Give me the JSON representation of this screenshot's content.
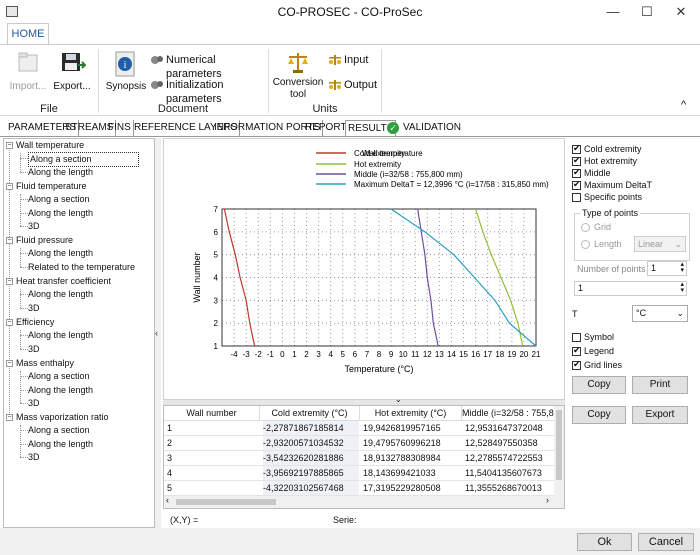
{
  "window": {
    "title": "CO-PROSEC - CO-ProSec",
    "minimize": "—",
    "maximize": "☐",
    "close": "✕"
  },
  "ribbon": {
    "tab": "HOME",
    "file": {
      "import": "Import...",
      "export": "Export...",
      "group": "File"
    },
    "document": {
      "synopsis": "Synopsis",
      "numerical": "Numerical parameters",
      "init": "Initialization parameters",
      "group": "Document"
    },
    "units": {
      "conversion": "Conversion",
      "tool": "tool",
      "input": "Input",
      "output": "Output",
      "group": "Units"
    },
    "collapse": "^"
  },
  "tabs": [
    "PARAMETERS",
    "STREAMS",
    "FINS",
    "REFERENCE LAYERS",
    "INFORMATION PORTS",
    "REPORTS",
    "RESULTS",
    "VALIDATION"
  ],
  "tree": [
    {
      "label": "Wall temperature",
      "children": [
        "Along a section",
        "Along the length"
      ]
    },
    {
      "label": "Fluid temperature",
      "children": [
        "Along a section",
        "Along the length",
        "3D"
      ]
    },
    {
      "label": "Fluid pressure",
      "children": [
        "Along the length",
        "Related to the temperature"
      ]
    },
    {
      "label": "Heat transfer coefficient",
      "children": [
        "Along the length",
        "3D"
      ]
    },
    {
      "label": "Efficiency",
      "children": [
        "Along the length",
        "3D"
      ]
    },
    {
      "label": "Mass enthalpy",
      "children": [
        "Along a section",
        "Along the length",
        "3D"
      ]
    },
    {
      "label": "Mass vaporization ratio",
      "children": [
        "Along a section",
        "Along the length",
        "3D"
      ]
    }
  ],
  "chart_data": {
    "type": "line",
    "legend_overlay": "Wall temperature",
    "series": [
      {
        "name": "Cold extremity",
        "color": "#c0392b",
        "x": [
          -4.8,
          -4.4,
          -3.9,
          -3.5,
          -3.0,
          -2.7,
          -2.3
        ],
        "y": [
          7,
          6,
          5,
          4,
          3,
          2,
          1
        ]
      },
      {
        "name": "Hot extremity",
        "color": "#8fbf3a",
        "x": [
          16,
          16.6,
          17.3,
          18.1,
          18.9,
          19.5,
          19.9
        ],
        "y": [
          7,
          6,
          5,
          4,
          3,
          2,
          1
        ]
      },
      {
        "name": "Middle (i=32/58 : 755,800 mm)",
        "color": "#6b4fa0",
        "x": [
          11.2,
          11.5,
          11.8,
          12.0,
          12.3,
          12.5,
          12.9
        ],
        "y": [
          7,
          6,
          5,
          4,
          3,
          2,
          1
        ]
      },
      {
        "name": "Maximum DeltaT = 12,3996 °C (i=17/58 : 315,850 mm)",
        "color": "#2a9fc4",
        "x": [
          9.0,
          11.8,
          14.2,
          15.9,
          17.6,
          18.8,
          21.0
        ],
        "y": [
          7,
          6,
          5,
          4,
          3,
          2,
          1
        ]
      }
    ],
    "xlabel": "Temperature (°C)",
    "ylabel": "Wall number",
    "xlim": [
      -5,
      21
    ],
    "ylim": [
      1,
      7
    ],
    "xticks": [
      "-4",
      "-3",
      "-2",
      "-1",
      "0",
      "1",
      "2",
      "3",
      "4",
      "5",
      "6",
      "7",
      "8",
      "9",
      "10",
      "11",
      "12",
      "13",
      "14",
      "15",
      "16",
      "17",
      "18",
      "19",
      "20",
      "21"
    ],
    "yticks": [
      "1",
      "2",
      "3",
      "4",
      "5",
      "6",
      "7"
    ],
    "grid": true
  },
  "options": {
    "checks": [
      {
        "label": "Cold extremity",
        "on": true
      },
      {
        "label": "Hot extremity",
        "on": true
      },
      {
        "label": "Middle",
        "on": true
      },
      {
        "label": "Maximum DeltaT",
        "on": true
      },
      {
        "label": "Specific points",
        "on": false
      }
    ],
    "type_group": "Type of points",
    "grid": "Grid",
    "length": "Length",
    "linear": "Linear",
    "num_points_label": "Number of points",
    "num_points": "1",
    "second_value": "1",
    "t_label": "T",
    "t_unit": "°C",
    "symbol": "Symbol",
    "symbol_on": false,
    "legend": "Legend",
    "legend_on": true,
    "gridlines": "Grid lines",
    "gridlines_on": true,
    "copy": "Copy",
    "print": "Print"
  },
  "table": {
    "headers": [
      "Wall number",
      "Cold extremity (°C)",
      "Hot extremity (°C)",
      "Middle (i=32/58 : 755,80"
    ],
    "rows": [
      [
        "1",
        "-2,27871867185814",
        "19,9426819957165",
        "12,9531647372048"
      ],
      [
        "2",
        "-2,93200571034532",
        "19,4795760996218",
        "12,528497550358"
      ],
      [
        "3",
        "-3,54232620281886",
        "18,9132788308984",
        "12,2785574722553"
      ],
      [
        "4",
        "-3,95692197885865",
        "18,143699421033",
        "11,5404135607673"
      ],
      [
        "5",
        "-4,32203102567468",
        "17,3195229280508",
        "11,3555268670013"
      ]
    ],
    "copy": "Copy",
    "export": "Export",
    "xy": "(X,Y) =",
    "serie": "Serie:"
  },
  "footer": {
    "ok": "Ok",
    "cancel": "Cancel"
  }
}
